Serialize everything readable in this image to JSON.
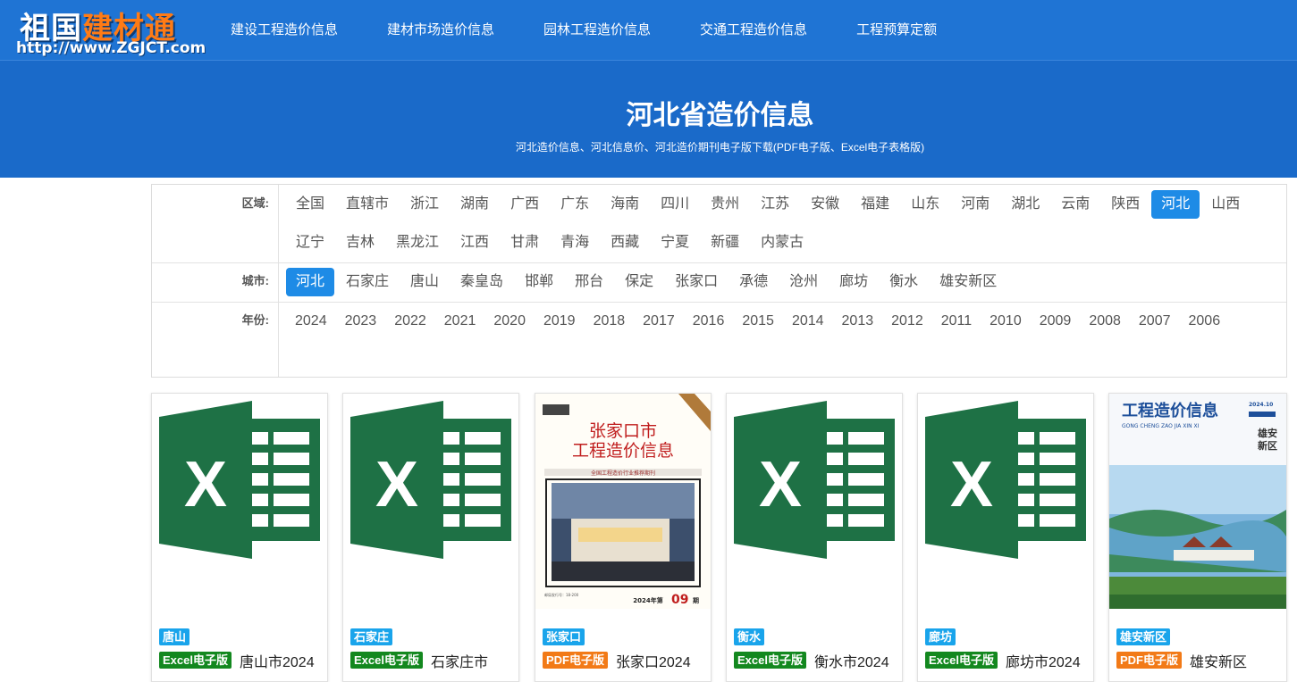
{
  "logo": {
    "part1": "祖国",
    "part2": "建材通",
    "url": "http://www.ZGJCT.com"
  },
  "nav": [
    "建设工程造价信息",
    "建材市场造价信息",
    "园林工程造价信息",
    "交通工程造价信息",
    "工程预算定额"
  ],
  "banner": {
    "title": "河北省造价信息",
    "subtitle": "河北造价信息、河北信息价、河北造价期刊电子版下载(PDF电子版、Excel电子表格版)"
  },
  "filters": {
    "region": {
      "label": "区域:",
      "active": "河北",
      "items": [
        "全国",
        "直辖市",
        "浙江",
        "湖南",
        "广西",
        "广东",
        "海南",
        "四川",
        "贵州",
        "江苏",
        "安徽",
        "福建",
        "山东",
        "河南",
        "湖北",
        "云南",
        "陕西",
        "河北",
        "山西",
        "辽宁",
        "吉林",
        "黑龙江",
        "江西",
        "甘肃",
        "青海",
        "西藏",
        "宁夏",
        "新疆",
        "内蒙古"
      ]
    },
    "city": {
      "label": "城市:",
      "active": "河北",
      "items": [
        "河北",
        "石家庄",
        "唐山",
        "秦皇岛",
        "邯郸",
        "邢台",
        "保定",
        "张家口",
        "承德",
        "沧州",
        "廊坊",
        "衡水",
        "雄安新区"
      ]
    },
    "year": {
      "label": "年份:",
      "items": [
        "2024",
        "2023",
        "2022",
        "2021",
        "2020",
        "2019",
        "2018",
        "2017",
        "2016",
        "2015",
        "2014",
        "2013",
        "2012",
        "2011",
        "2010",
        "2009",
        "2008",
        "2007",
        "2006"
      ]
    }
  },
  "cards": [
    {
      "tag": "唐山",
      "type": "Excel电子版",
      "kind": "excel",
      "title": "唐山市2024"
    },
    {
      "tag": "石家庄",
      "type": "Excel电子版",
      "kind": "excel",
      "title": "石家庄市"
    },
    {
      "tag": "张家口",
      "type": "PDF电子版",
      "kind": "pdf",
      "title": "张家口2024",
      "cover": {
        "line1": "张家口市",
        "line2": "工程造价信息",
        "banner": "全国工程造价行业推荐期刊",
        "issue": "2024年第",
        "issue_no": "09",
        "issue_suffix": "期"
      }
    },
    {
      "tag": "衡水",
      "type": "Excel电子版",
      "kind": "excel",
      "title": "衡水市2024"
    },
    {
      "tag": "廊坊",
      "type": "Excel电子版",
      "kind": "excel",
      "title": "廊坊市2024"
    },
    {
      "tag": "雄安新区",
      "type": "PDF电子版",
      "kind": "pdf",
      "title": "雄安新区",
      "cover": {
        "line1": "工程造价信息",
        "line2": "GONG CHENG ZAO JIA XIN XI",
        "side1": "雄安",
        "side2": "新区",
        "date": "2024.10"
      }
    }
  ],
  "colors": {
    "topbar": "#1f74d4",
    "banner": "#1a6ac9",
    "active": "#1e8be6",
    "excel": "#13881f",
    "pdf": "#f27a17",
    "tag": "#19a4eb",
    "excel_icon": "#1e7145"
  }
}
